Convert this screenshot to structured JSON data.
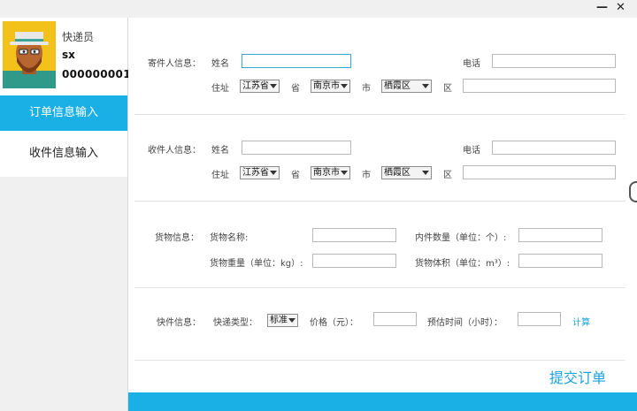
{
  "window": {
    "minimize_glyph": "—",
    "close_glyph": "✕"
  },
  "user": {
    "role": "快递员",
    "name": "sx",
    "id": "000000001"
  },
  "nav": {
    "active": "订单信息输入",
    "inactive": "收件信息输入"
  },
  "sender": {
    "section": "寄件人信息：",
    "name_label": "姓名",
    "phone_label": "电话",
    "addr_label": "住址",
    "province": "江苏省",
    "province_unit": "省",
    "city": "南京市",
    "city_unit": "市",
    "district": "栖霞区",
    "district_unit": "区",
    "name_value": "",
    "phone_value": "",
    "addr_value": ""
  },
  "receiver": {
    "section": "收件人信息：",
    "name_label": "姓名",
    "phone_label": "电话",
    "addr_label": "住址",
    "province": "江苏省",
    "province_unit": "省",
    "city": "南京市",
    "city_unit": "市",
    "district": "栖霞区",
    "district_unit": "区",
    "name_value": "",
    "phone_value": "",
    "addr_value": ""
  },
  "goods": {
    "section": "货物信息：",
    "name_label": "货物名称:",
    "count_label": "内件数量（单位：个）:",
    "weight_label": "货物重量（单位：kg）:",
    "volume_label": "货物体积（单位：m³）:",
    "name_value": "",
    "count_value": "",
    "weight_value": "",
    "volume_value": ""
  },
  "express": {
    "section": "快件信息：",
    "type_label": "快递类型：",
    "type_value": "标准",
    "price_label": "价格（元）：",
    "time_label": "预估时间（小时）：",
    "price_value": "",
    "time_value": "",
    "calc_label": "计算"
  },
  "submit_label": "提交订单",
  "colors": {
    "accent": "#1ab0e6",
    "link": "#1aa3dc"
  }
}
